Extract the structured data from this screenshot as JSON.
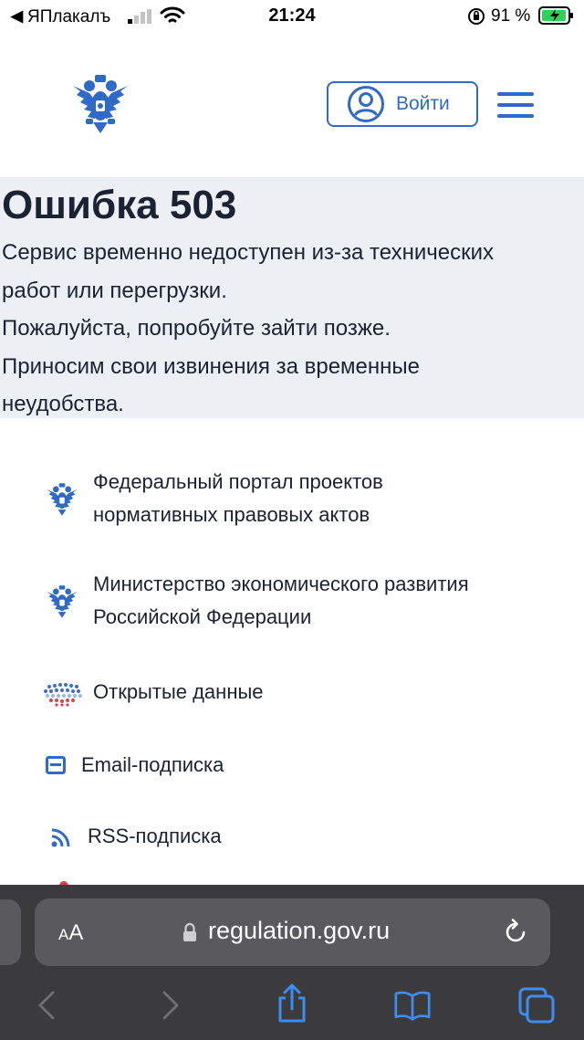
{
  "status_bar": {
    "back_arrow": "◀",
    "carrier": "ЯПлакалъ",
    "time": "21:24",
    "battery_percent": "91 %"
  },
  "header": {
    "login_label": "Войти",
    "icons": [
      "eagle-emblem-icon",
      "user-icon",
      "hamburger-menu-icon"
    ]
  },
  "error": {
    "title": "Ошибка 503",
    "lines": [
      "Сервис временно недоступен из-за технических",
      "работ или перегрузки.",
      "Пожалуйста, попробуйте зайти позже.",
      "Приносим свои извинения за временные",
      "неудобства."
    ]
  },
  "links": [
    {
      "icon": "eagle-emblem-icon",
      "line1": "Федеральный портал проектов",
      "line2": "нормативных правовых актов"
    },
    {
      "icon": "eagle-emblem-icon",
      "line1": "Министерство экономического развития",
      "line2": "Российской Федерации"
    },
    {
      "icon": "open-data-icon",
      "line1": "Открытые данные"
    },
    {
      "icon": "email-icon",
      "line1": "Email-подписка"
    },
    {
      "icon": "rss-icon",
      "line1": "RSS-подписка"
    }
  ],
  "browser": {
    "text_size_label": "AA",
    "url": "regulation.gov.ru",
    "buttons": [
      "back-icon",
      "forward-icon",
      "share-icon",
      "bookmarks-icon",
      "tabs-icon"
    ]
  },
  "colors": {
    "accent": "#2f6bc6",
    "text": "#1b2232",
    "error_bg": "#eceff3",
    "browser_bg": "#3b3b3d"
  }
}
